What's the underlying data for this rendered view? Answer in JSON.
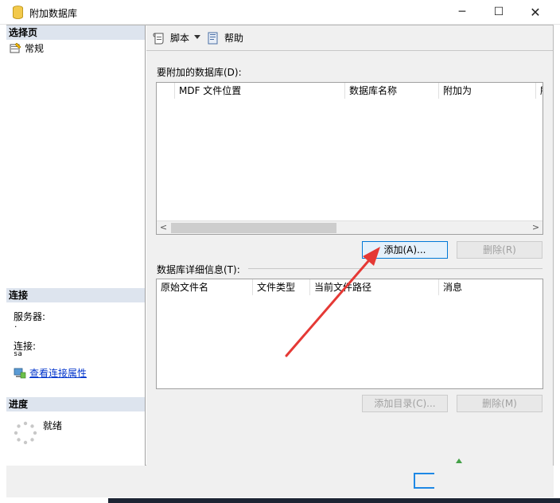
{
  "window": {
    "title": "附加数据库",
    "minimize_glyph": "─",
    "maximize_glyph": "☐",
    "close_glyph": "✕"
  },
  "left_pane": {
    "pages_header": "选择页",
    "pages": [
      {
        "label": "常规",
        "icon": "page-icon"
      }
    ],
    "connection_header": "连接",
    "server_label": "服务器:",
    "server_value": ".",
    "connection_label": "连接:",
    "connection_value": "sa",
    "view_connection_link": "查看连接属性",
    "progress_header": "进度",
    "progress_status": "就绪"
  },
  "toolbar": {
    "script_label": "脚本",
    "help_label": "帮助"
  },
  "databases_to_attach": {
    "label": "要附加的数据库(D):",
    "columns": [
      "MDF 文件位置",
      "数据库名称",
      "附加为",
      "所"
    ],
    "rows": [],
    "add_button": "添加(A)...",
    "remove_button": "删除(R)"
  },
  "database_details": {
    "label": "数据库详细信息(T):",
    "columns": [
      "原始文件名",
      "文件类型",
      "当前文件路径",
      "消息"
    ],
    "rows": [],
    "add_catalog_button": "添加目录(C)...",
    "remove_button": "删除(M)"
  },
  "colors": {
    "section_header_bg": "#dde4ee",
    "link": "#0033cc",
    "focus_border": "#0078d7",
    "annotation_arrow": "#e53935"
  }
}
